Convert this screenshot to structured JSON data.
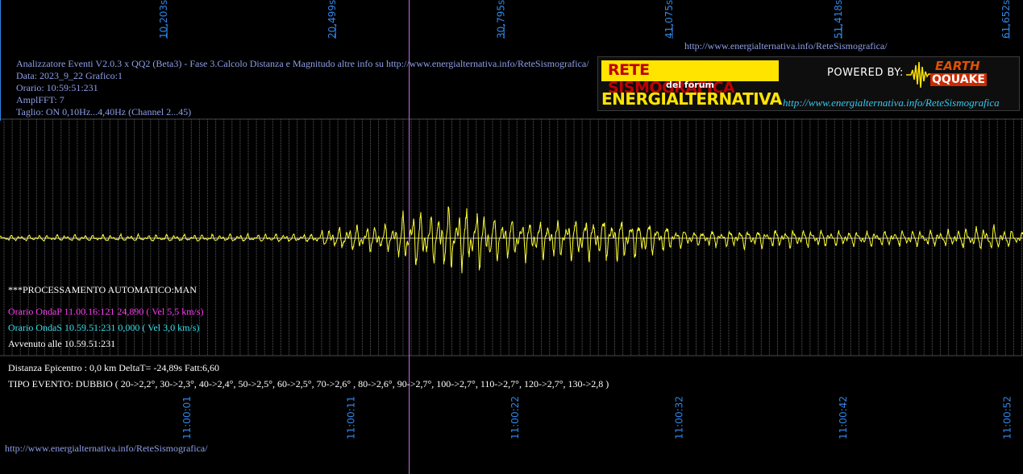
{
  "header": {
    "title": "Analizzatore Eventi V2.0.3 x QQ2 (Beta3) - Fase 3.Calcolo Distanza e Magnitudo altre info su http://www.energialternativa.info/ReteSismografica/",
    "data": "Data: 2023_9_22 Grafico:1",
    "orario": "Orario: 10:59:51:231",
    "amplfft": "AmplFFT: 7",
    "taglio": "Taglio: ON 0,10Hz...4,40Hz       (Channel 2...45)"
  },
  "top_url": "http://www.energialternativa.info/ReteSismografica/",
  "logo": {
    "line1": "RETE SISMOGRAFICA",
    "line2": "del forum",
    "line3": "ENERGIALTERNATIVA",
    "powered": "POWERED BY:",
    "earth": "EARTH",
    "quake": "QQUAKE",
    "url": "http://www.energialternativa.info/ReteSismografica"
  },
  "processing": {
    "mode": "***PROCESSAMENTO AUTOMATICO:MAN",
    "onda_p": "Orario OndaP 11.00.16:121  24,890 ( Vel 5,5 km/s)",
    "onda_s": "Orario OndaS 10.59.51:231  0,000 ( Vel 3,0 km/s)",
    "avvenuto": "Avvenuto alle 10.59.51:231"
  },
  "results": {
    "distanza": "Distanza Epicentro : 0,0 km DeltaT= -24,89s  Fatt:6,60",
    "tipo": "TIPO EVENTO: DUBBIO ( 20->2,2°, 30->2,3°, 40->2,4°, 50->2,5°, 60->2,5°, 70->2,6° , 80->2,6°, 90->2,7°, 100->2,7°, 110->2,7°, 120->2,7°, 130->2,8 )"
  },
  "bottom_url": "http://www.energialternativa.info/ReteSismografica/",
  "colors": {
    "background": "#000000",
    "signal": "#ffff33",
    "grid": "#5a5a5a",
    "axis_label": "#2f86e6",
    "marker": "#d070f0",
    "text_blue": "#8f9fe8"
  },
  "chart_data": {
    "type": "line",
    "top_axis": {
      "unit": "s",
      "ticks": [
        {
          "value": 10.203,
          "label": "10,203s"
        },
        {
          "value": 20.499,
          "label": "20,499s"
        },
        {
          "value": 30.795,
          "label": "30,795s"
        },
        {
          "value": 41.075,
          "label": "41,075s"
        },
        {
          "value": 51.418,
          "label": "51,418s"
        },
        {
          "value": 61.652,
          "label": "61,652s"
        }
      ]
    },
    "bottom_axis": {
      "ticks": [
        "11:00:01",
        "11:00:11",
        "11:00:22",
        "11:00:32",
        "11:00:42",
        "11:00:52"
      ]
    },
    "x_range_s": [
      0,
      62.5
    ],
    "marker_s": 25.0,
    "baseline": 0,
    "series": [
      {
        "envelope": [
          {
            "t": 0,
            "amp": 0.07
          },
          {
            "t": 19,
            "amp": 0.1
          },
          {
            "t": 20.5,
            "amp": 0.28
          },
          {
            "t": 24,
            "amp": 0.35
          },
          {
            "t": 25.1,
            "amp": 0.75
          },
          {
            "t": 26.5,
            "amp": 0.55
          },
          {
            "t": 27,
            "amp": 0.85
          },
          {
            "t": 29,
            "amp": 0.75
          },
          {
            "t": 30.5,
            "amp": 0.55
          },
          {
            "t": 33,
            "amp": 0.45
          },
          {
            "t": 37,
            "amp": 0.55
          },
          {
            "t": 40,
            "amp": 0.4
          },
          {
            "t": 42,
            "amp": 0.2
          },
          {
            "t": 48,
            "amp": 0.22
          },
          {
            "t": 52,
            "amp": 0.18
          },
          {
            "t": 58,
            "amp": 0.2
          },
          {
            "t": 60.5,
            "amp": 0.32
          },
          {
            "t": 62.5,
            "amp": 0.15
          }
        ]
      }
    ]
  }
}
